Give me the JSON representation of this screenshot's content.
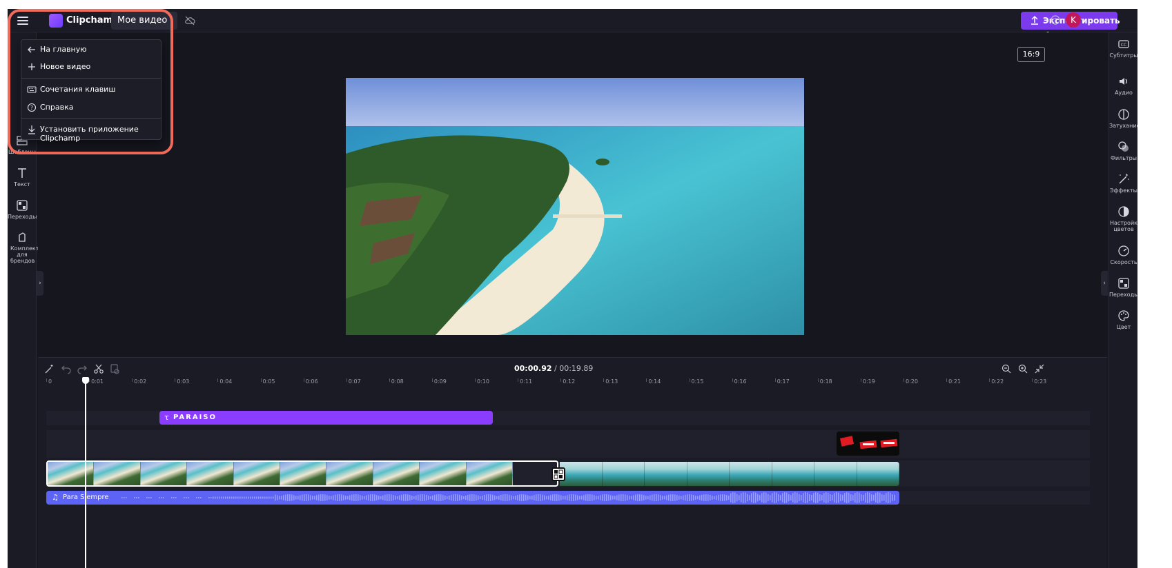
{
  "topbar": {
    "brand": "Clipchamp",
    "video_title": "Мое видео",
    "export_label": "Экспортировать",
    "avatar_letter": "K"
  },
  "menu": {
    "items": [
      {
        "label": "На главную",
        "icon": "arrow-left-icon"
      },
      {
        "label": "Новое видео",
        "icon": "plus-icon"
      },
      {
        "label": "Сочетания клавиш",
        "icon": "keyboard-icon"
      },
      {
        "label": "Справка",
        "icon": "help-icon"
      },
      {
        "label": "Установить приложение Clipchamp",
        "icon": "download-icon"
      }
    ]
  },
  "leftbar": {
    "items": [
      {
        "label": "Шаблоны",
        "icon": "templates-icon"
      },
      {
        "label": "Текст",
        "icon": "text-icon"
      },
      {
        "label": "Переходы",
        "icon": "transitions-icon"
      },
      {
        "label": "Комплект для брендов",
        "icon": "brand-kit-icon"
      }
    ]
  },
  "rightbar": {
    "items": [
      {
        "label": "Субтитры",
        "icon": "captions-icon"
      },
      {
        "label": "Аудио",
        "icon": "speaker-icon"
      },
      {
        "label": "Затухание",
        "icon": "fade-icon"
      },
      {
        "label": "Фильтры",
        "icon": "filters-icon"
      },
      {
        "label": "Эффекты",
        "icon": "effects-icon"
      },
      {
        "label": "Настройка цветов",
        "icon": "color-adjust-icon"
      },
      {
        "label": "Скорость",
        "icon": "speed-icon"
      },
      {
        "label": "Переходы",
        "icon": "transitions-icon"
      },
      {
        "label": "Цвет",
        "icon": "palette-icon"
      }
    ]
  },
  "preview": {
    "aspect_ratio": "16:9"
  },
  "timeline": {
    "current_time": "00:00.92",
    "separator": " / ",
    "total_time": "00:19.89",
    "ticks": [
      "0",
      "0:01",
      "0:02",
      "0:03",
      "0:04",
      "0:05",
      "0:06",
      "0:07",
      "0:08",
      "0:09",
      "0:10",
      "0:11",
      "0:12",
      "0:13",
      "0:14",
      "0:15",
      "0:16",
      "0:17",
      "0:18",
      "0:19",
      "0:20",
      "0:21",
      "0:22",
      "0:23"
    ],
    "text_clip": "PARAISO",
    "audio_clip": "Para Siempre"
  },
  "colors": {
    "accent": "#7c3aed",
    "text_clip": "#8b3dff",
    "audio_clip": "#5d63f4",
    "highlight": "#f26b5b"
  }
}
